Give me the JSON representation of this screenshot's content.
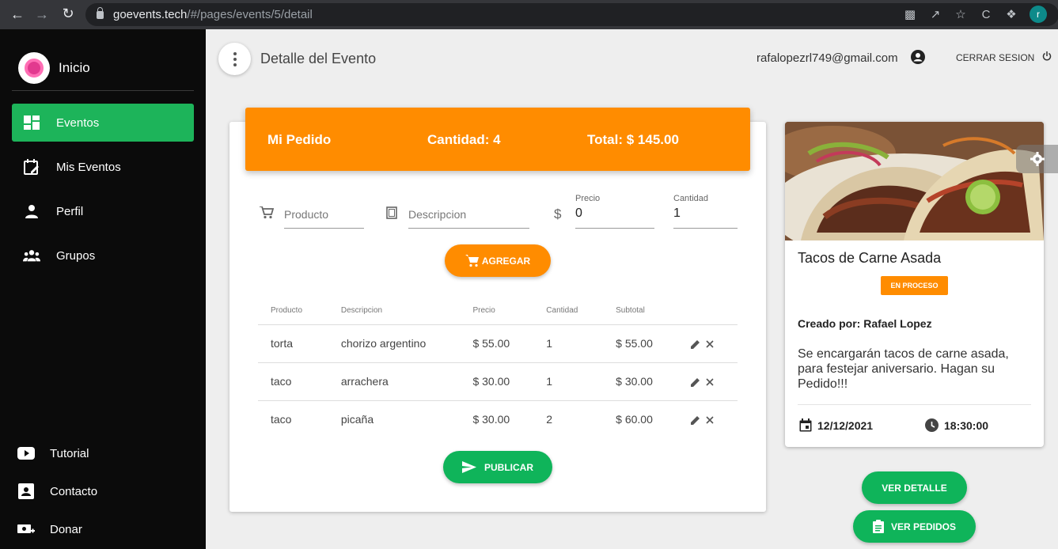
{
  "browser": {
    "url_domain": "goevents.tech",
    "url_path": "/#/pages/events/5/detail",
    "profile_initial": "r"
  },
  "sidebar": {
    "brand_title": "Inicio",
    "items": [
      {
        "label": "Eventos",
        "icon": "dashboard-icon",
        "active": true
      },
      {
        "label": "Mis Eventos",
        "icon": "calendar-edit-icon",
        "active": false
      },
      {
        "label": "Perfil",
        "icon": "person-icon",
        "active": false
      },
      {
        "label": "Grupos",
        "icon": "group-icon",
        "active": false
      }
    ],
    "bottom_items": [
      {
        "label": "Tutorial",
        "icon": "youtube-icon"
      },
      {
        "label": "Contacto",
        "icon": "contact-icon"
      },
      {
        "label": "Donar",
        "icon": "donate-icon"
      }
    ]
  },
  "header": {
    "title": "Detalle del Evento",
    "user_email": "rafalopezrl749@gmail.com",
    "logout_label": "CERRAR SESION"
  },
  "order": {
    "title": "Mi Pedido",
    "quantity": "Cantidad: 4",
    "total": "Total: $ 145.00",
    "form": {
      "product_placeholder": "Producto",
      "description_placeholder": "Descripcion",
      "price_label": "Precio",
      "price_value": "0",
      "quantity_label": "Cantidad",
      "quantity_value": "1"
    },
    "add_button": "AGREGAR",
    "publish_button": "PUBLICAR",
    "columns": [
      "Producto",
      "Descripcion",
      "Precio",
      "Cantidad",
      "Subtotal"
    ],
    "rows": [
      [
        "torta",
        "chorizo argentino",
        "$ 55.00",
        "1",
        "$ 55.00"
      ],
      [
        "taco",
        "arrachera",
        "$ 30.00",
        "1",
        "$ 30.00"
      ],
      [
        "taco",
        "picaña",
        "$ 30.00",
        "2",
        "$ 60.00"
      ]
    ]
  },
  "event": {
    "title": "Tacos de Carne Asada",
    "status": "EN PROCESO",
    "creator": "Creado por: Rafael Lopez",
    "description": "Se encargarán tacos de carne asada, para festejar aniversario. Hagan su Pedido!!!",
    "date": "12/12/2021",
    "time": "18:30:00",
    "detail_button": "VER DETALLE",
    "orders_button": "VER PEDIDOS"
  },
  "colors": {
    "accent_green": "#1db45a",
    "accent_orange": "#ff8c00",
    "sidebar_bg": "#0b0b0b"
  }
}
